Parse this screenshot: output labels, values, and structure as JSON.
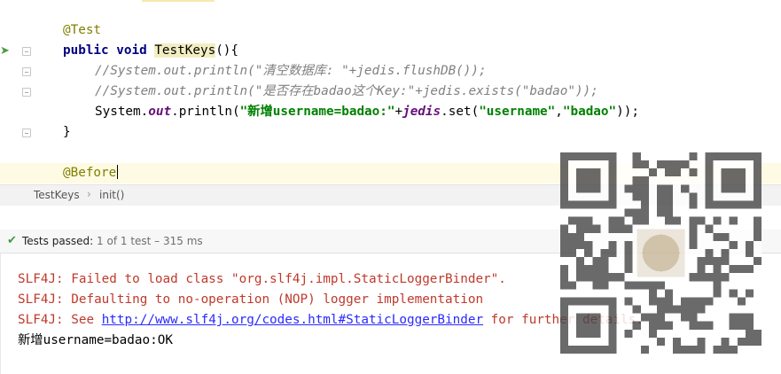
{
  "editor": {
    "lines": [
      {
        "annotation": "@Test"
      },
      {
        "kw1": "public",
        "kw2": "void",
        "method": "TestKeys",
        "rest": "(){"
      },
      {
        "comment": "//System.out.println(\"清空数据库: \"+jedis.flushDB());"
      },
      {
        "comment": "//System.out.println(\"是否存在badao这个Key:\"+jedis.exists(\"badao\"));"
      },
      {
        "s1": "System.",
        "s2": "out",
        "s3": ".println(",
        "s4": "\"新增username=badao:\"",
        "s5": "+",
        "s6": "jedis",
        "s7": ".set(",
        "s8": "\"username\"",
        "s9": ",",
        "s10": "\"badao\"",
        "s11": "));"
      },
      {
        "brace": "}"
      },
      {
        "annotation": "@Before"
      }
    ]
  },
  "breadcrumb": {
    "items": [
      "TestKeys",
      "init()"
    ],
    "separator": "›"
  },
  "test_status": {
    "icon": "check-icon",
    "label": "Tests passed:",
    "detail": " 1 of 1 test – 315 ms"
  },
  "console": {
    "line1": "SLF4J: Failed to load class \"org.slf4j.impl.StaticLoggerBinder\".",
    "line2": "SLF4J: Defaulting to no-operation (NOP) logger implementation",
    "line3_prefix": "SLF4J: See ",
    "line3_link": "http://www.slf4j.org/codes.html#StaticLoggerBinder",
    "line3_suffix": " for further details.",
    "line4": "新增username=badao:OK"
  },
  "colors": {
    "keyword": "#000080",
    "annotation": "#808000",
    "comment": "#808080",
    "string": "#008000",
    "error": "#c0392b",
    "link": "#2a2aff",
    "pass": "#3e9a3e"
  },
  "icons": [
    "run-test-icon",
    "fold-icon",
    "check-icon",
    "qr-code-icon"
  ]
}
